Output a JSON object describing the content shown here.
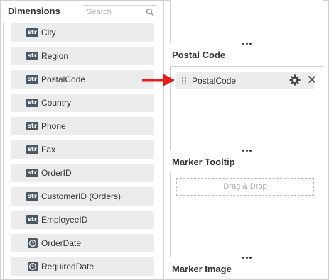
{
  "dimensions_panel": {
    "title": "Dimensions",
    "search_placeholder": "Search",
    "items": [
      {
        "type": "str",
        "label": "City"
      },
      {
        "type": "str",
        "label": "Region"
      },
      {
        "type": "str",
        "label": "PostalCode"
      },
      {
        "type": "str",
        "label": "Country"
      },
      {
        "type": "str",
        "label": "Phone"
      },
      {
        "type": "str",
        "label": "Fax"
      },
      {
        "type": "str",
        "label": "OrderID"
      },
      {
        "type": "str",
        "label": "CustomerID (Orders)"
      },
      {
        "type": "str",
        "label": "EmployeeID"
      },
      {
        "type": "date",
        "label": "OrderDate",
        "icon": "clock-icon"
      },
      {
        "type": "date",
        "label": "RequiredDate",
        "icon": "clock-icon"
      }
    ]
  },
  "right_panel": {
    "postal_code": {
      "title": "Postal Code",
      "field": "PostalCode"
    },
    "marker_tooltip": {
      "title": "Marker Tooltip",
      "drop_text": "Drag & Drop"
    },
    "marker_image": {
      "title": "Marker Image"
    }
  },
  "colors": {
    "badge": "#4a5866",
    "arrow": "#e81c1c",
    "item_bg": "#ececec"
  }
}
